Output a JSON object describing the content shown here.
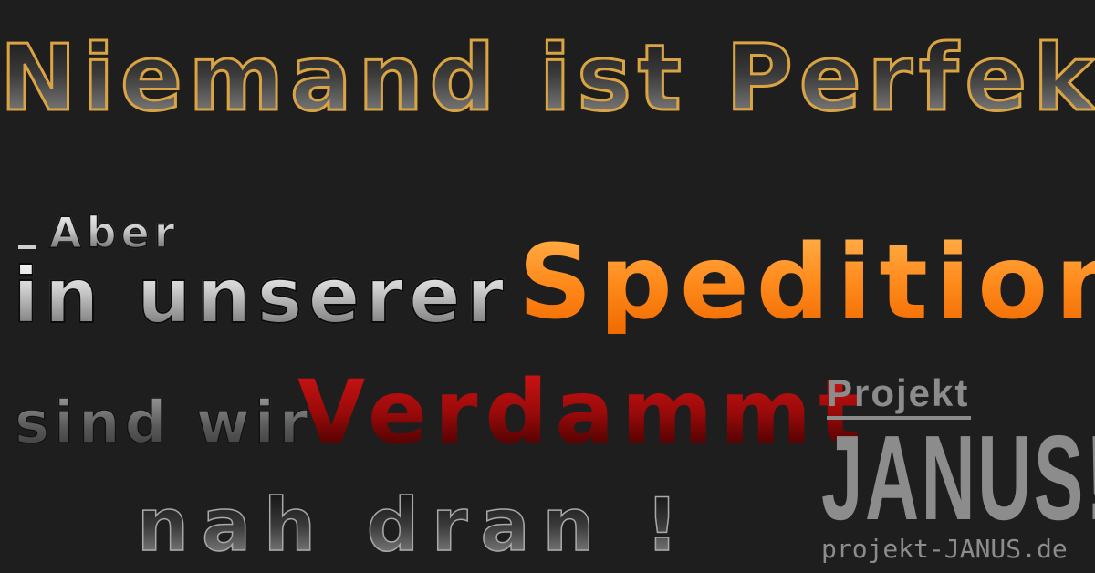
{
  "headline": {
    "title": "Niemand ist Perfekt",
    "aber": "Aber",
    "in_unserer": "in unserer",
    "spedition": "Spedition",
    "sind_wir": "sind wir",
    "verdammt": "Verdammt",
    "nah_dran": "nah dran !"
  },
  "logo": {
    "projekt": "Projekt",
    "janus": "JANUS!",
    "url": "projekt-JANUS.de"
  },
  "colors": {
    "background": "#1e1e1e",
    "title_outline": "#d9a441",
    "spedition_orange": "#ff8a1c",
    "verdammt_red": "#b00e0e",
    "logo_gray": "#8c8c8c"
  }
}
